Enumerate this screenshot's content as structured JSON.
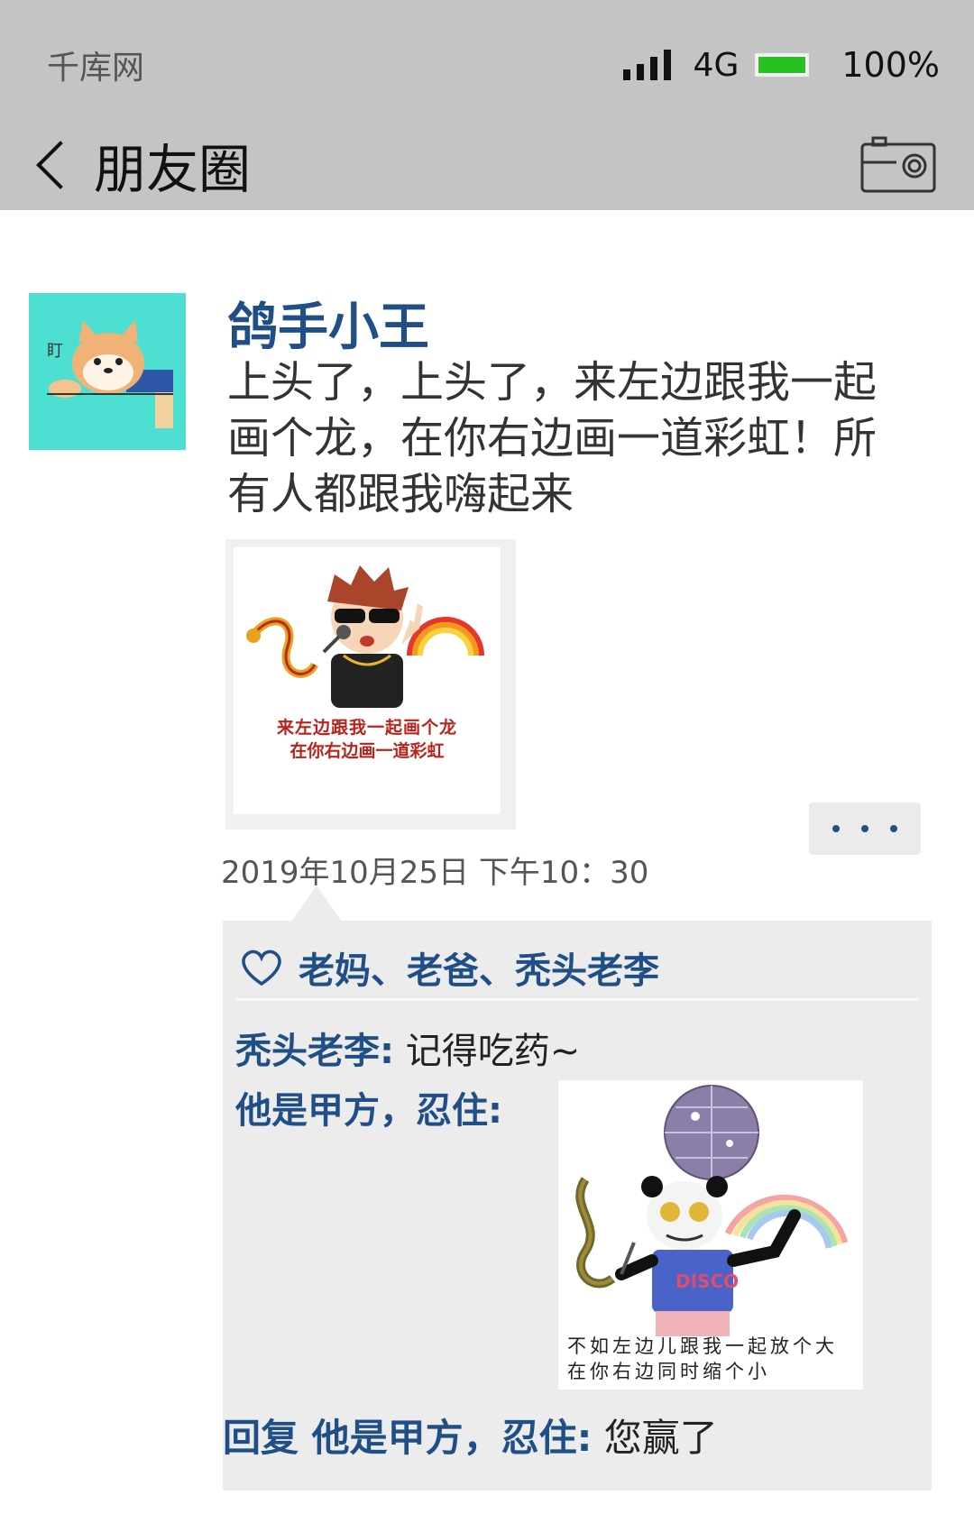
{
  "status_bar": {
    "carrier": "千库网",
    "network": "4G",
    "battery_level": 100,
    "battery_percent": "100%",
    "signal_icon": "signal-bars-icon",
    "battery_icon": "battery-icon"
  },
  "nav": {
    "back_icon": "chevron-left-icon",
    "title": "朋友圈",
    "camera_icon": "camera-icon"
  },
  "post": {
    "avatar": "shiba-dog-avatar",
    "avatar_text": "盯",
    "username": "鸽手小王",
    "text": "上头了，上头了，来左边跟我一起画个龙，在你右边画一道彩虹！所有人都跟我嗨起来",
    "image_caption_line1": "来左边跟我一起画个龙",
    "image_caption_line2": "在你右边画一道彩虹",
    "timestamp": "2019年10月25日 下午10：30",
    "more_icon": "more-dots-icon"
  },
  "likes": {
    "icon": "heart-icon",
    "names": "老妈、老爸、秃头老李"
  },
  "comments": [
    {
      "name": "秃头老李:",
      "text": " 记得吃药~"
    },
    {
      "name": "他是甲方，忍住:",
      "text": ""
    }
  ],
  "comment_image": {
    "badge": "DISCO",
    "caption_line1": "不如左边儿跟我一起放个大",
    "caption_line2": "在你右边同时缩个小"
  },
  "reply": {
    "prefix": "回复",
    "target": " 他是甲方，忍住:",
    "text": " 您赢了"
  },
  "colors": {
    "header_bg": "#c4c4c4",
    "name_blue": "#1f4f86",
    "battery_green": "#27c21f",
    "panel_bg": "#ececec",
    "avatar_bg": "#4de0d2"
  }
}
